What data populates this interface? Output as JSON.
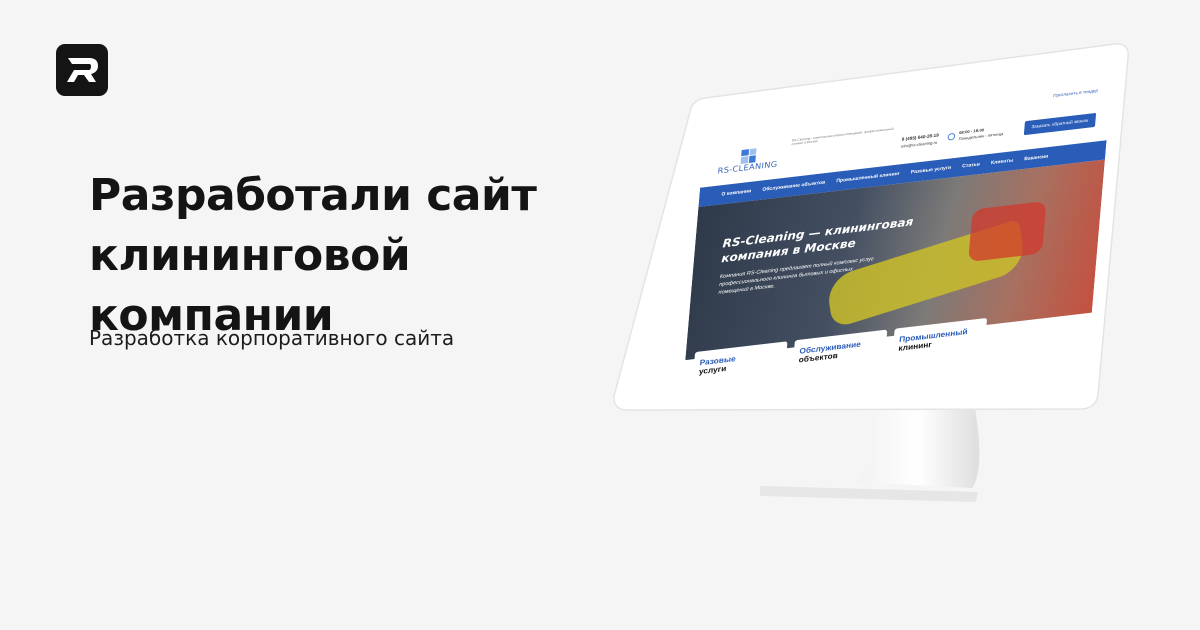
{
  "headline": "Разработали сайт клининговой компании",
  "subline": "Разработка корпоративного сайта",
  "brand": {
    "logo_icon": "r-logo-icon",
    "bg": "#141414"
  },
  "site": {
    "topbar_link": "Пригласить в тендер",
    "logo_text": "RS-CLEANING",
    "tagline": "RS-Cleaning - комплексная уборка помещений, профессиональный клининг в Москве",
    "phone": "8 (495) 640-28-18",
    "email": "info@rs-cleaning.ru",
    "hours": "08:00 - 18:00",
    "days": "Понедельник - пятница",
    "cta": "Заказать обратный звонок",
    "nav": [
      "О компании",
      "Обслуживание объектов",
      "Промышленный клининг",
      "Разовые услуги",
      "Статьи",
      "Клиенты",
      "Вакансии"
    ],
    "hero_title": "RS-Cleaning — клининговая компания в Москве",
    "hero_text": "Компания RS-Cleaning предлагает полный комплекс услуг профессионального клининга бытовых и офисных помещений в Москве.",
    "cards": [
      {
        "line1": "Разовые",
        "line2": "услуги"
      },
      {
        "line1": "Обслуживание",
        "line2": "объектов"
      },
      {
        "line1": "Промышленный",
        "line2": "клининг"
      }
    ],
    "accent": "#2a5db8"
  }
}
